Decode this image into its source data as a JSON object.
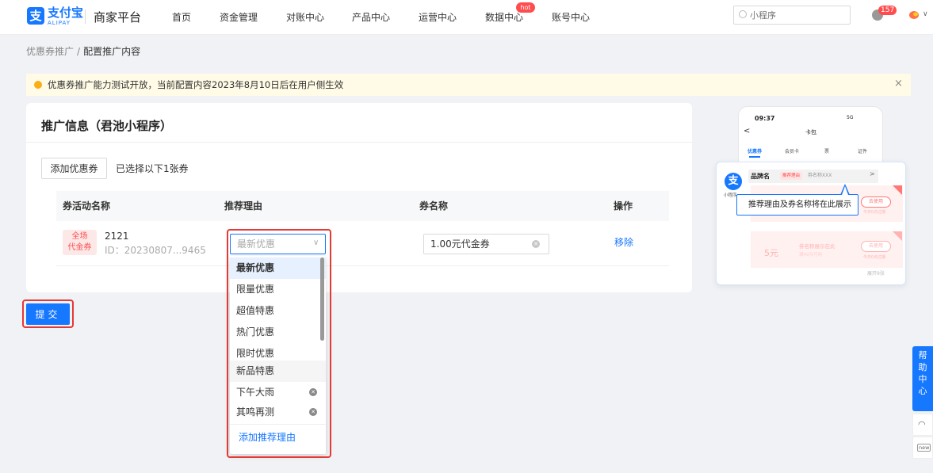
{
  "header": {
    "logo_char": "支",
    "logo_text": "支付宝",
    "logo_sub": "ALIPAY",
    "platform": "商家平台",
    "nav": [
      {
        "label": "首页"
      },
      {
        "label": "资金管理"
      },
      {
        "label": "对账中心"
      },
      {
        "label": "产品中心"
      },
      {
        "label": "运营中心"
      },
      {
        "label": "数据中心"
      },
      {
        "label": "账号中心"
      }
    ],
    "hot_badge": "hot",
    "search_placeholder": "小程序",
    "notif_count": "157"
  },
  "breadcrumb": {
    "parent": "优惠券推广",
    "separator": "/",
    "current": "配置推广内容"
  },
  "alert": {
    "text": "优惠券推广能力测试开放，当前配置内容2023年8月10日后在用户侧生效",
    "close": "×"
  },
  "card": {
    "title": "推广信息（君池小程序）",
    "add_button": "添加优惠券",
    "selected_text": "已选择以下1张券",
    "columns": [
      "券活动名称",
      "推荐理由",
      "券名称",
      "操作"
    ],
    "row": {
      "tag_line1": "全场",
      "tag_line2": "代金券",
      "name": "2121",
      "id": "ID：20230807...9465",
      "reason_placeholder": "最新优惠",
      "coupon_name": "1.00元代金券",
      "action": "移除"
    }
  },
  "dropdown": {
    "options": [
      {
        "label": "最新优惠",
        "deletable": false,
        "active": true
      },
      {
        "label": "限量优惠",
        "deletable": false
      },
      {
        "label": "超值特惠",
        "deletable": false
      },
      {
        "label": "热门优惠",
        "deletable": false
      },
      {
        "label": "限时优惠",
        "deletable": false
      },
      {
        "label": "新品特惠",
        "deletable": false,
        "hover": true
      },
      {
        "label": "下午大雨",
        "deletable": true
      },
      {
        "label": "其鸣再测",
        "deletable": true
      }
    ],
    "add_label": "添加推荐理由"
  },
  "submit_label": "提交",
  "preview": {
    "time": "09:37",
    "status": "5G",
    "title": "卡包",
    "tabs": [
      "优惠券",
      "会员卡",
      "票",
      "证件"
    ],
    "brand": "品牌名",
    "reason_tag": "推荐理由",
    "coupon_name": "券名称XXX",
    "mini_label": "小程序",
    "tooltip": "推荐理由及券名称将在此展示",
    "use_button": "去使用",
    "expire": "今日0点过期",
    "amount": "5元",
    "card2_text1": "券名称展示在此",
    "card2_text2": "满40元可用",
    "expand": "展开9张"
  },
  "help": {
    "label": "帮助中心",
    "new_label": "new"
  },
  "colors": {
    "primary": "#1677ff",
    "danger": "#ff4d4f",
    "highlight": "#e53935",
    "alert_bg": "#fffbe6"
  }
}
